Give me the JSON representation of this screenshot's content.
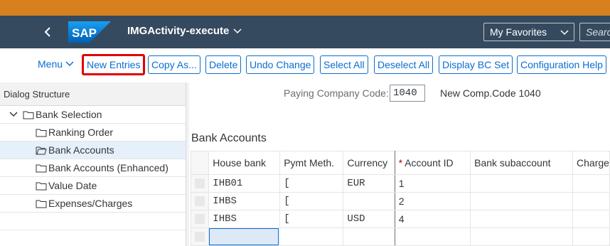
{
  "shell": {
    "title": "IMGActivity-execute",
    "favorites_label": "My Favorites",
    "search_placeholder": "Search"
  },
  "toolbar": {
    "menu_label": "Menu",
    "buttons": [
      "New Entries",
      "Copy As...",
      "Delete",
      "Undo Change",
      "Select All",
      "Deselect All",
      "Display BC Set",
      "Configuration Help"
    ]
  },
  "dialog_structure": {
    "header": "Dialog Structure",
    "items": [
      {
        "label": "Bank Selection"
      },
      {
        "label": "Ranking Order"
      },
      {
        "label": "Bank Accounts"
      },
      {
        "label": "Bank Accounts (Enhanced)"
      },
      {
        "label": "Value Date"
      },
      {
        "label": "Expenses/Charges"
      }
    ]
  },
  "paying_company": {
    "label": "Paying Company Code:",
    "value": "1040",
    "description": "New Comp.Code 1040"
  },
  "bank_accounts": {
    "title": "Bank Accounts",
    "columns": [
      "House bank",
      "Pymt Meth.",
      "Currency",
      "Account ID",
      "Bank subaccount",
      "Charge"
    ],
    "rows": [
      {
        "house_bank": "IHB01",
        "pymt_meth": "[",
        "currency": "EUR",
        "account_id": "1",
        "bank_subaccount": "",
        "charge": ""
      },
      {
        "house_bank": "IHBS",
        "pymt_meth": "[",
        "currency": "",
        "account_id": "2",
        "bank_subaccount": "",
        "charge": ""
      },
      {
        "house_bank": "IHBS",
        "pymt_meth": "[",
        "currency": "USD",
        "account_id": "4",
        "bank_subaccount": "",
        "charge": ""
      }
    ]
  },
  "colors": {
    "shell_bg": "#354a5f",
    "accent": "#0a6ed1",
    "highlight": "#e00000",
    "top_bar": "#d6801f"
  }
}
